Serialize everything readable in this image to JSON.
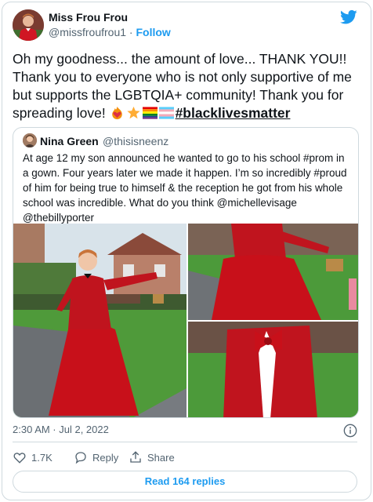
{
  "author": {
    "name": "Miss Frou Frou",
    "handle": "@missfroufrou1",
    "separator": " · ",
    "follow_label": "Follow",
    "avatar_icon": "profile-photo",
    "logo_icon": "twitter-bird-icon"
  },
  "tweet": {
    "text": "Oh my goodness... the amount of love... THANK YOU!! Thank you to everyone who is not only supportive of me but supports the LGBTQIA+ community! Thank you for spreading love! ",
    "emojis": [
      "heart-on-fire",
      "star",
      "rainbow-flag",
      "transgender-flag"
    ],
    "hashtag": "#blacklivesmatter"
  },
  "quoted": {
    "name": "Nina Green",
    "handle": "@thisisneenz",
    "text": "At age 12 my son announced he wanted to go to his school #prom in a gown. Four years later we made it happen. I’m so incredibly #proud of him for being true to himself & the reception he got from his whole school was incredible. What do you think @michellevisage @thebillyporter",
    "photos": [
      "full-length-red-gown-photo",
      "red-gown-side-photo",
      "red-sequin-jacket-bowtie-photo"
    ]
  },
  "meta": {
    "timestamp": "2:30 AM · Jul 2, 2022"
  },
  "actions": {
    "like_count": "1.7K",
    "reply_label": "Reply",
    "share_label": "Share"
  },
  "read_replies_label": "Read 164 replies",
  "colors": {
    "accent": "#1d9bf0",
    "text": "#0f1419",
    "muted": "#536471",
    "border": "#cfd9de",
    "gown_red": "#c8101a"
  }
}
